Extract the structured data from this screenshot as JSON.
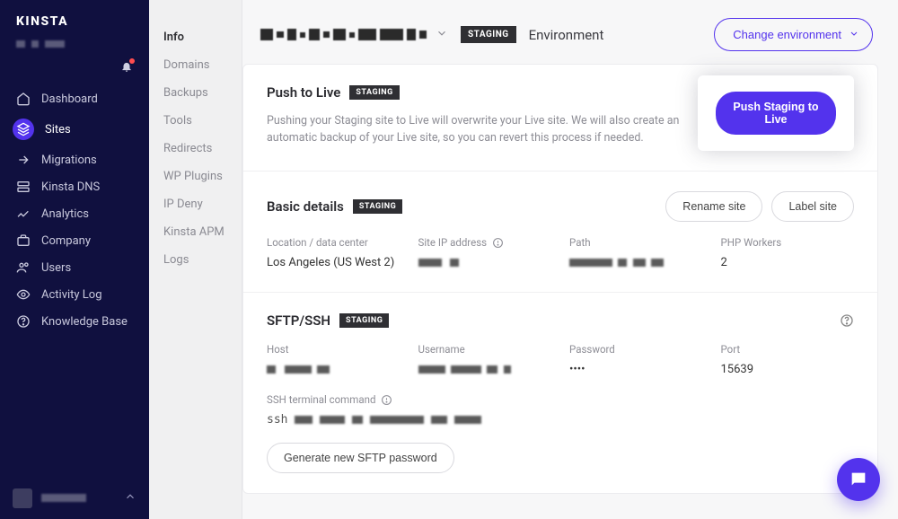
{
  "brand": "KINSTA",
  "nav": {
    "items": [
      {
        "label": "Dashboard"
      },
      {
        "label": "Sites",
        "active": true
      },
      {
        "label": "Migrations"
      },
      {
        "label": "Kinsta DNS"
      },
      {
        "label": "Analytics"
      },
      {
        "label": "Company"
      },
      {
        "label": "Users"
      },
      {
        "label": "Activity Log"
      },
      {
        "label": "Knowledge Base"
      }
    ]
  },
  "subnav": {
    "items": [
      {
        "label": "Info",
        "active": true
      },
      {
        "label": "Domains"
      },
      {
        "label": "Backups"
      },
      {
        "label": "Tools"
      },
      {
        "label": "Redirects"
      },
      {
        "label": "WP Plugins"
      },
      {
        "label": "IP Deny"
      },
      {
        "label": "Kinsta APM"
      },
      {
        "label": "Logs"
      }
    ]
  },
  "header": {
    "staging_badge": "STAGING",
    "env_label": "Environment",
    "change_env": "Change environment"
  },
  "push": {
    "title": "Push to Live",
    "badge": "STAGING",
    "desc": "Pushing your Staging site to Live will overwrite your Live site. We will also create an automatic backup of your Live site, so you can revert this process if needed.",
    "cta": "Push Staging to Live"
  },
  "basic": {
    "title": "Basic details",
    "badge": "STAGING",
    "rename": "Rename site",
    "label": "Label site",
    "fields": {
      "location_label": "Location / data center",
      "location_value": "Los Angeles (US West 2)",
      "ip_label": "Site IP address",
      "path_label": "Path",
      "workers_label": "PHP Workers",
      "workers_value": "2"
    }
  },
  "sftp": {
    "title": "SFTP/SSH",
    "badge": "STAGING",
    "host_label": "Host",
    "user_label": "Username",
    "pass_label": "Password",
    "pass_value": "••••",
    "port_label": "Port",
    "port_value": "15639",
    "ssh_cmd_label": "SSH terminal command",
    "ssh_prefix": "ssh",
    "gen_btn": "Generate new SFTP password"
  }
}
